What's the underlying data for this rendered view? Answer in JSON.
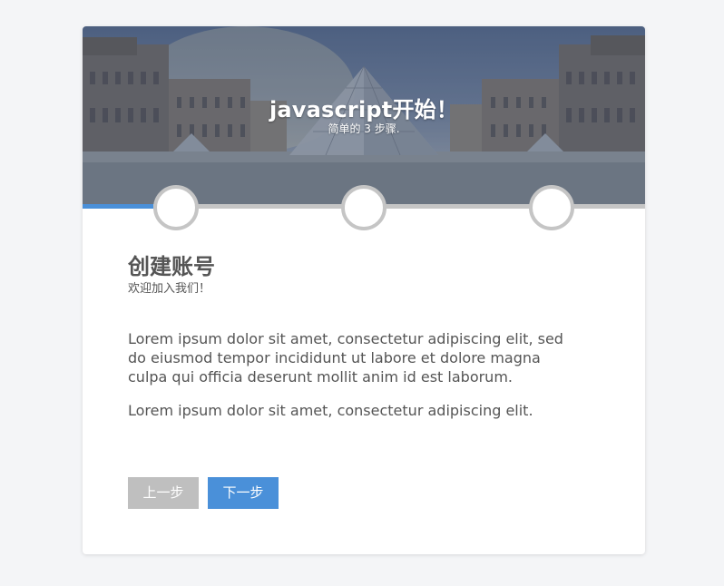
{
  "header": {
    "title": "javascript开始！",
    "subtitle": "简单的 3 步骤."
  },
  "progress": {
    "total_steps": 3,
    "current_step": 1,
    "fill_fraction": 0.125
  },
  "step": {
    "title": "创建账号",
    "subtitle": "欢迎加入我们！",
    "paragraphs": [
      "Lorem ipsum dolor sit amet, consectetur adipiscing elit, sed do eiusmod tempor incididunt ut labore et dolore magna culpa qui officia deserunt mollit anim id est laborum.",
      "Lorem ipsum dolor sit amet, consectetur adipiscing elit."
    ]
  },
  "buttons": {
    "prev_label": "上一步",
    "next_label": "下一步"
  },
  "colors": {
    "accent": "#4a90d9",
    "track": "#c5c5c5",
    "disabled_button": "#bfbfbf",
    "text": "#555555"
  }
}
